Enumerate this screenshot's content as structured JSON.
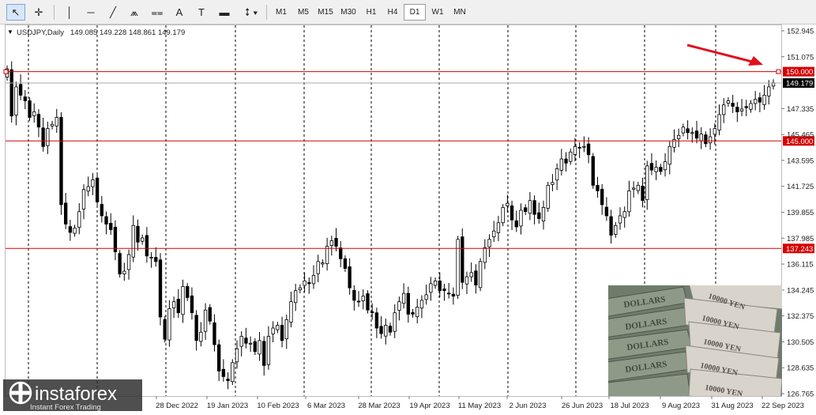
{
  "toolbar": {
    "tools": [
      {
        "name": "cursor-tool",
        "glyph": "↖"
      },
      {
        "name": "crosshair-tool",
        "glyph": "✛"
      },
      {
        "name": "vertical-line-tool",
        "glyph": "│"
      },
      {
        "name": "horizontal-line-tool",
        "glyph": "─"
      },
      {
        "name": "trendline-tool",
        "glyph": "╱"
      },
      {
        "name": "fibonacci-tool",
        "glyph": "⩕"
      },
      {
        "name": "channel-tool",
        "glyph": "⩵"
      },
      {
        "name": "text-tool",
        "glyph": "A"
      },
      {
        "name": "text-label-tool",
        "glyph": "T"
      },
      {
        "name": "rectangle-tool",
        "glyph": "▬"
      },
      {
        "name": "arrows-tool",
        "glyph": "⭥ ▾"
      }
    ],
    "timeframes": [
      "M1",
      "M5",
      "M15",
      "M30",
      "H1",
      "H4",
      "D1",
      "W1",
      "MN"
    ],
    "selected_timeframe": "D1"
  },
  "chart": {
    "symbol_label": "USDJPY,Daily",
    "ohlc": "149.085 149.228 148.861 149.179",
    "price_labels": [
      "152.945",
      "151.075",
      "149.179",
      "147.335",
      "145.465",
      "143.595",
      "141.725",
      "139.855",
      "137.985",
      "136.115",
      "134.245",
      "132.375",
      "130.505",
      "128.635",
      "126.765"
    ],
    "date_labels": [
      "28 Dec 2022",
      "19 Jan 2023",
      "10 Feb 2023",
      "6 Mar 2023",
      "28 Mar 2023",
      "19 Apr 2023",
      "11 May 2023",
      "2 Jun 2023",
      "26 Jun 2023",
      "18 Jul 2023",
      "9 Aug 2023",
      "31 Aug 2023",
      "22 Sep 2023"
    ],
    "levels": [
      {
        "price": "150.000",
        "color": "#d50000"
      },
      {
        "price": "145.000",
        "color": "#d50000"
      },
      {
        "price": "137.243",
        "color": "#d50000"
      }
    ],
    "current_price": "149.179",
    "arrow_color": "#e0101c"
  },
  "overlay": {
    "logo_text": "instaforex",
    "logo_tagline": "Instant Forex Trading"
  },
  "chart_data": {
    "type": "candlestick",
    "symbol": "USDJPY",
    "timeframe": "Daily",
    "ylim": [
      126.765,
      152.945
    ],
    "horizontal_levels": [
      150.0,
      145.0,
      137.243
    ],
    "last_close": 149.179,
    "series": [
      {
        "name": "USDJPY",
        "close": [
          150.2,
          146.8,
          148.9,
          148.3,
          147.9,
          146.7,
          147.1,
          146.0,
          144.6,
          145.9,
          146.2,
          146.7,
          140.4,
          139.0,
          138.4,
          138.7,
          139.9,
          141.5,
          141.7,
          142.2,
          140.6,
          139.6,
          139.0,
          138.6,
          137.0,
          135.4,
          135.6,
          136.8,
          138.9,
          137.7,
          138.0,
          136.7,
          136.6,
          136.3,
          132.3,
          130.7,
          132.9,
          133.4,
          132.6,
          134.5,
          133.7,
          132.6,
          130.6,
          131.2,
          132.8,
          132.0,
          130.3,
          128.4,
          128.0,
          127.7,
          129.0,
          130.0,
          130.9,
          130.4,
          130.4,
          129.8,
          130.6,
          128.8,
          130.9,
          131.5,
          131.7,
          130.6,
          132.1,
          133.4,
          134.2,
          134.4,
          134.9,
          134.7,
          135.3,
          136.3,
          136.2,
          137.4,
          137.8,
          137.4,
          136.5,
          135.8,
          134.4,
          133.5,
          133.4,
          133.8,
          132.8,
          132.6,
          131.5,
          131.1,
          131.7,
          131.2,
          132.6,
          133.4,
          134.0,
          132.5,
          132.5,
          133.0,
          133.5,
          133.9,
          134.7,
          134.9,
          134.2,
          134.2,
          134.0,
          133.8,
          137.9,
          134.8,
          135.2,
          135.5,
          134.6,
          136.3,
          137.3,
          137.9,
          138.5,
          139.1,
          140.2,
          140.5,
          139.3,
          138.8,
          140.0,
          139.9,
          140.7,
          139.7,
          139.4,
          140.2,
          141.8,
          142.0,
          143.0,
          143.7,
          143.4,
          144.2,
          144.6,
          144.5,
          144.6,
          144.0,
          141.8,
          141.4,
          140.4,
          139.6,
          138.2,
          138.9,
          139.6,
          139.9,
          141.4,
          141.6,
          141.8,
          140.7,
          143.2,
          142.9,
          143.1,
          142.8,
          143.5,
          144.6,
          145.1,
          145.4,
          146.0,
          145.6,
          145.6,
          145.2,
          145.5,
          144.8,
          145.3,
          145.9,
          146.9,
          147.6,
          147.9,
          147.5,
          147.1,
          147.3,
          147.4,
          147.7,
          148.0,
          147.8,
          148.3,
          148.9,
          149.2
        ]
      }
    ]
  }
}
